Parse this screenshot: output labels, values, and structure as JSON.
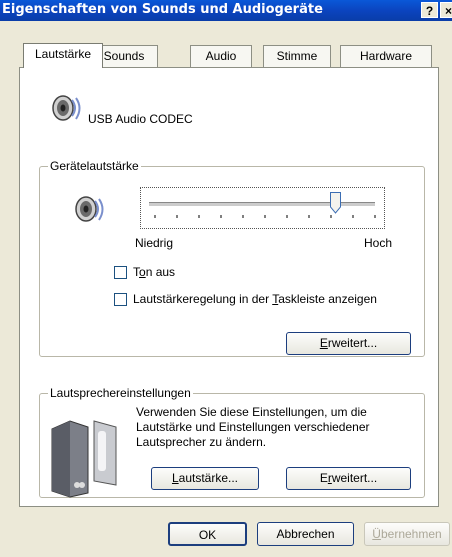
{
  "window": {
    "title": "Eigenschaften von Sounds und Audiogeräte",
    "help_btn": "?",
    "close_btn": "×"
  },
  "tabs": [
    {
      "label": "Lautstärke",
      "active": true
    },
    {
      "label": "Sounds",
      "active": false
    },
    {
      "label": "Audio",
      "active": false
    },
    {
      "label": "Stimme",
      "active": false
    },
    {
      "label": "Hardware",
      "active": false
    }
  ],
  "device": {
    "name": "USB Audio CODEC",
    "icon": "speaker-icon"
  },
  "volume_group": {
    "label": "Gerätelautstärke",
    "slider_value": 0.82,
    "low_label": "Niedrig",
    "high_label": "Hoch",
    "mute": {
      "label_pre": "T",
      "label_ul": "o",
      "label_post": "n aus",
      "checked": false
    },
    "taskbar": {
      "label_pre": "Lautstärkeregelung in der ",
      "label_ul": "T",
      "label_post": "askleiste anzeigen",
      "checked": false
    },
    "advanced_btn": {
      "ul": "E",
      "rest": "rweitert..."
    }
  },
  "speaker_group": {
    "label": "Lautsprechereinstellungen",
    "desc_line1": "Verwenden Sie diese Einstellungen, um die",
    "desc_line2": "Lautstärke und Einstellungen verschiedener",
    "desc_line3": "Lautsprecher zu ändern.",
    "volume_btn": {
      "ul": "L",
      "rest": "autstärke..."
    },
    "advanced_btn": {
      "pre": "E",
      "ul": "r",
      "rest": "weitert..."
    }
  },
  "footer": {
    "ok": "OK",
    "cancel": "Abbrechen",
    "apply_ul": "Ü",
    "apply_rest": "bernehmen"
  }
}
